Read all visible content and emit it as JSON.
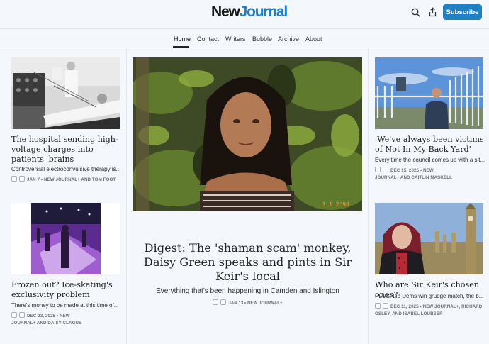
{
  "header": {
    "logo_part1": "New",
    "logo_part2": "Journal",
    "subscribe_label": "Subscribe"
  },
  "nav": {
    "items": [
      "Home",
      "Contact",
      "Writers",
      "Bubble",
      "Archive",
      "About"
    ]
  },
  "articles": {
    "hospital": {
      "title": "The hospital sending high-voltage charges into patients' brains",
      "desc": "Controversial electroconvulsive therapy is...",
      "meta": "JAN 7 • NEW JOURNAL+ AND TOM FOOT"
    },
    "skating": {
      "title": "Frozen out? Ice-skating's exclusivity problem",
      "desc": "There's money to be made at this time of...",
      "meta_line1": "DEC 23, 2025 • NEW",
      "meta_line2": "JOURNAL+ AND DAISY CLAGUE"
    },
    "digest": {
      "title": "Digest: The 'shaman scam' monkey, Daisy Green speaks and pints in Sir Keir's local",
      "desc": "Everything that's been happening in Camden and Islington",
      "meta": "JAN 13 • NEW JOURNAL+",
      "photo_stamp": "1 1 2'98"
    },
    "nimby": {
      "title": "'We've always been victims of Not In My Back Yard'",
      "desc": "Every time the council comes up with a sit...",
      "meta_line1": "DEC 15, 2025 • NEW",
      "meta_line2": "JOURNAL+ AND CAITLIN MASKELL"
    },
    "keir": {
      "title": "Who are Sir Keir's chosen ones?",
      "desc": "PLUS: Lib Dems win grudge match, the b...",
      "meta_line1": "DEC 11, 2025 • NEW JOURNAL+, RICHARD",
      "meta_line2": "OSLEY, AND ISABEL LOUBSER"
    }
  },
  "colors": {
    "accent": "#1f80c6",
    "logo_blue": "#1a7fd0",
    "background": "#f4f8fc"
  }
}
